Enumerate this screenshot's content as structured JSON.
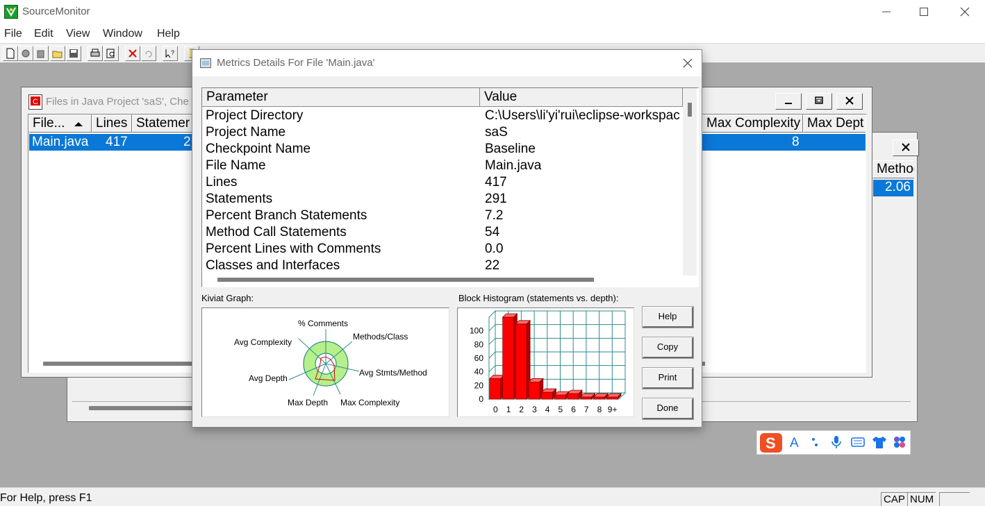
{
  "app": {
    "title": "SourceMonitor",
    "menu": [
      "File",
      "Edit",
      "View",
      "Window",
      "Help"
    ],
    "status_text": "For Help, press F1",
    "indicators": [
      "CAP",
      "NUM"
    ]
  },
  "files_window": {
    "title": "Files in Java Project 'saS', Che",
    "columns": [
      "File...",
      "Lines",
      "Statemer",
      "Max Complexity",
      "Max Dept"
    ],
    "row": {
      "file": "Main.java",
      "lines": "417",
      "statements": "2",
      "max_complexity": "8"
    }
  },
  "back_window": {
    "column": "Method",
    "value": "2.06"
  },
  "dialog": {
    "title": "Metrics Details For File 'Main.java'",
    "columns": [
      "Parameter",
      "Value"
    ],
    "rows": [
      {
        "param": "Project Directory",
        "value": "C:\\Users\\li'yi'rui\\eclipse-workspac"
      },
      {
        "param": "Project Name",
        "value": "saS"
      },
      {
        "param": "Checkpoint Name",
        "value": "Baseline"
      },
      {
        "param": "File Name",
        "value": "Main.java"
      },
      {
        "param": "Lines",
        "value": "417"
      },
      {
        "param": "Statements",
        "value": "291"
      },
      {
        "param": "Percent Branch Statements",
        "value": "7.2"
      },
      {
        "param": "Method Call Statements",
        "value": "54"
      },
      {
        "param": "Percent Lines with Comments",
        "value": "0.0"
      },
      {
        "param": "Classes and Interfaces",
        "value": "22"
      }
    ],
    "kiviat_label": "Kiviat Graph:",
    "kiviat_axes": [
      "% Comments",
      "Methods/Class",
      "Avg Stmts/Method",
      "Max Complexity",
      "Max Depth",
      "Avg Depth",
      "Avg Complexity"
    ],
    "histogram_label": "Block Histogram (statements vs. depth):",
    "buttons": {
      "help": "Help",
      "copy": "Copy",
      "print": "Print",
      "done": "Done"
    }
  },
  "chart_data": {
    "type": "bar",
    "title": "Block Histogram (statements vs. depth):",
    "categories": [
      "0",
      "1",
      "2",
      "3",
      "4",
      "5",
      "6",
      "7",
      "8",
      "9+"
    ],
    "values": [
      30,
      120,
      110,
      25,
      10,
      6,
      8,
      3,
      3,
      3
    ],
    "y_ticks": [
      "0",
      "20",
      "40",
      "60",
      "80",
      "100"
    ],
    "ylim": [
      0,
      120
    ],
    "bar_color": "#ff0000",
    "grid_color": "#2e8b8b"
  }
}
